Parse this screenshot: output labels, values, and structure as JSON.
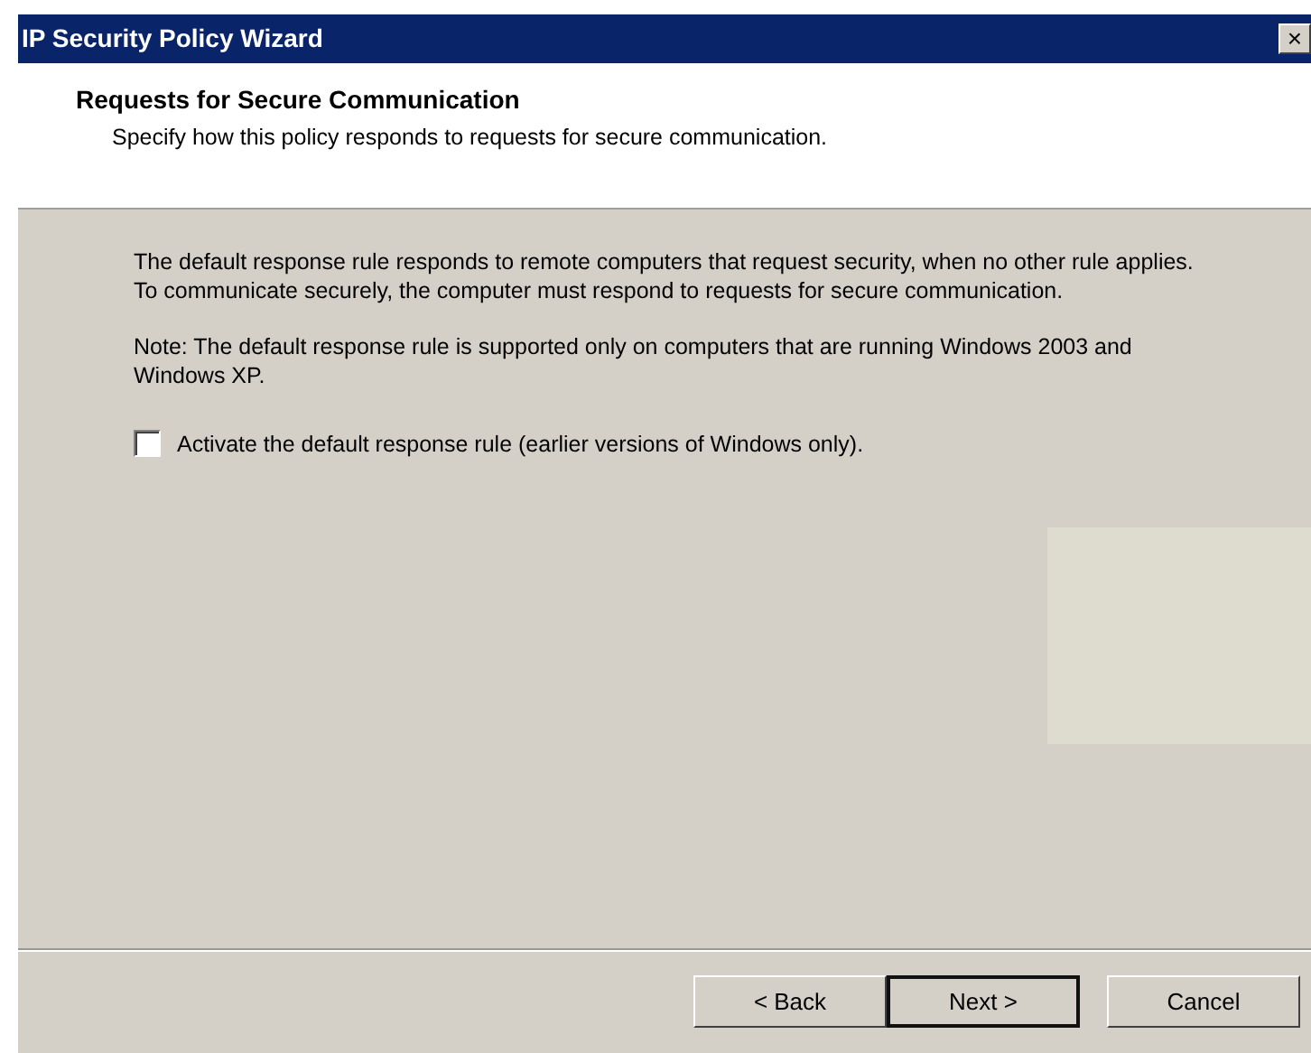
{
  "window": {
    "title": "IP Security Policy Wizard",
    "close": "×"
  },
  "header": {
    "title": "Requests for Secure Communication",
    "subtitle": "Specify how this policy responds to requests for secure communication."
  },
  "body": {
    "paragraphs": [
      "The default response rule responds to remote computers that request security, when no other rule applies. To communicate securely, the computer must respond to requests for secure communication.",
      "Note: The default response rule is supported only on computers that are running Windows 2003 and Windows XP."
    ],
    "checkbox": {
      "label": "Activate the default response rule (earlier versions of Windows only).",
      "checked": false
    }
  },
  "buttons": [
    {
      "label": "< Back",
      "default": false
    },
    {
      "label": "Next >",
      "default": true
    },
    {
      "label": "Cancel",
      "default": false
    }
  ]
}
